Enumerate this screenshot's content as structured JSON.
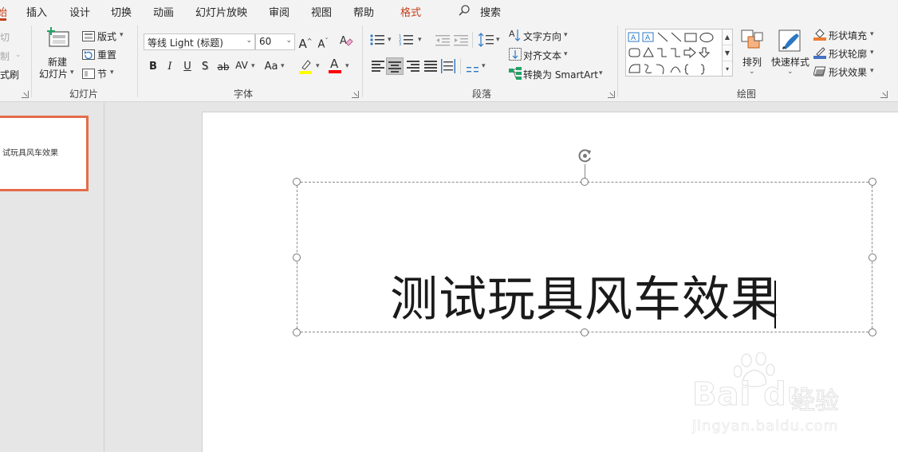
{
  "tabs": [
    {
      "label": "始",
      "active": true
    },
    {
      "label": "插入"
    },
    {
      "label": "设计"
    },
    {
      "label": "切换"
    },
    {
      "label": "动画"
    },
    {
      "label": "幻灯片放映"
    },
    {
      "label": "审阅"
    },
    {
      "label": "视图"
    },
    {
      "label": "帮助"
    },
    {
      "label": "格式",
      "contextual": true
    }
  ],
  "search": {
    "label": "搜索"
  },
  "clipboard": {
    "cut_label": "切",
    "copy_label": "制",
    "painter_label": "式刷"
  },
  "slides_group": {
    "new_slide_line1": "新建",
    "new_slide_line2": "幻灯片",
    "layout_label": "版式",
    "reset_label": "重置",
    "section_label": "节",
    "group_label": "幻灯片"
  },
  "font_group": {
    "font_name": "等线 Light (标题)",
    "font_size": "60",
    "grow_label": "A",
    "shrink_label": "A",
    "bold": "B",
    "italic": "I",
    "underline": "U",
    "shadow": "S",
    "strike": "ab",
    "spacing": "AV",
    "case": "Aa",
    "font_color": "A",
    "group_label": "字体"
  },
  "paragraph_group": {
    "text_direction_label": "文字方向",
    "align_text_label": "对齐文本",
    "smartart_label": "转换为 SmartArt",
    "group_label": "段落"
  },
  "drawing_group": {
    "arrange_label": "排列",
    "quick_styles_label": "快速样式",
    "shape_fill_label": "形状填充",
    "shape_outline_label": "形状轮廓",
    "shape_effects_label": "形状效果",
    "group_label": "绘图"
  },
  "colors": {
    "accent": "#c43e1c",
    "highlight": "#ffff00",
    "font_color": "#ff0000",
    "fill": "#ed7d31",
    "outline": "#4472c4",
    "thumb_border": "#e46c4a"
  },
  "thumbnail": {
    "text": "试玩具风车效果"
  },
  "slide": {
    "title": "测试玩具风车效果"
  },
  "watermark": {
    "logo": "Bai du",
    "jingyan": "经验",
    "url": "jingyan.baidu.com"
  }
}
